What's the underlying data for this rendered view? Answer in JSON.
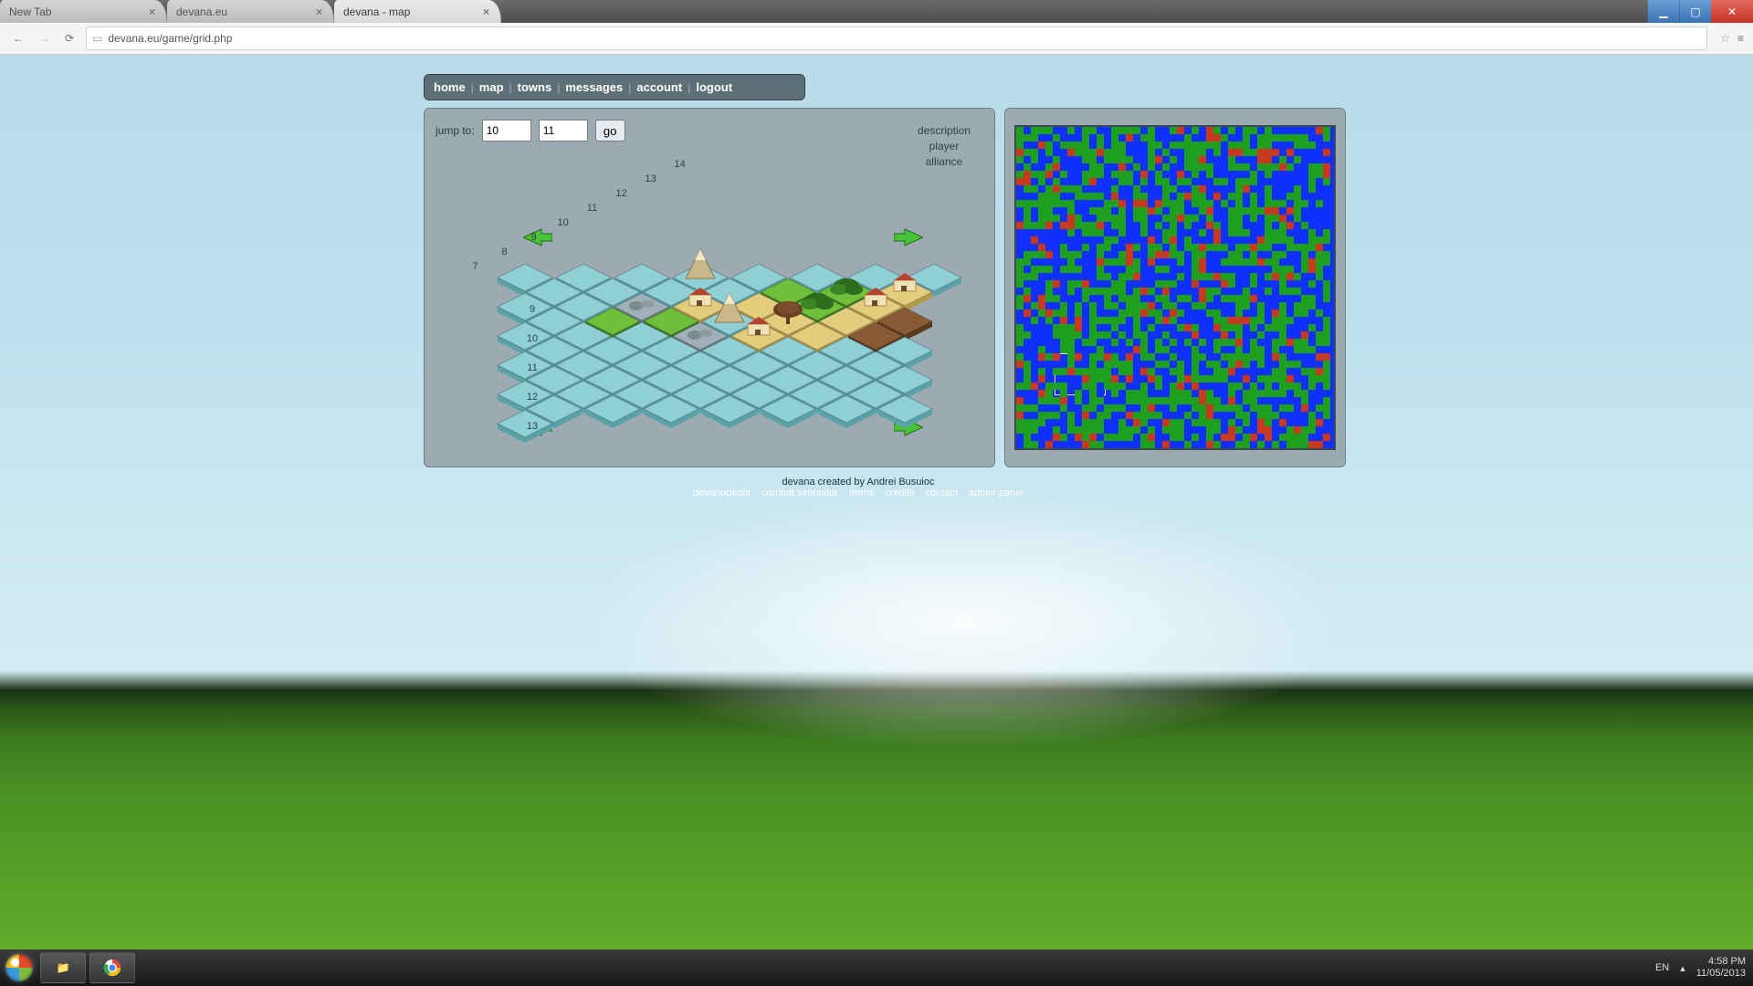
{
  "window": {
    "tabs": [
      {
        "title": "New Tab"
      },
      {
        "title": "devana.eu"
      },
      {
        "title": "devana - map"
      }
    ],
    "url": "devana.eu/game/grid.php"
  },
  "menu": [
    "home",
    "map",
    "towns",
    "messages",
    "account",
    "logout"
  ],
  "jump": {
    "label": "jump to:",
    "x": "10",
    "y": "11",
    "go": "go"
  },
  "info": {
    "l1": "description",
    "l2": "player",
    "l3": "alliance"
  },
  "axes": {
    "left": [
      "14",
      "13",
      "12",
      "11",
      "10",
      "9",
      "8",
      "7"
    ],
    "bottom": [
      "9",
      "10",
      "11",
      "12",
      "13"
    ]
  },
  "tiles": [
    {
      "r": 0,
      "c": 7,
      "t": "water"
    },
    {
      "r": 1,
      "c": 6,
      "t": "water"
    },
    {
      "r": 1,
      "c": 7,
      "t": "town"
    },
    {
      "r": 2,
      "c": 5,
      "t": "water"
    },
    {
      "r": 2,
      "c": 6,
      "t": "forest"
    },
    {
      "r": 2,
      "c": 7,
      "t": "town"
    },
    {
      "r": 2,
      "c": 8,
      "t": "dirt"
    },
    {
      "r": 3,
      "c": 4,
      "t": "water"
    },
    {
      "r": 3,
      "c": 5,
      "t": "grass"
    },
    {
      "r": 3,
      "c": 6,
      "t": "forest"
    },
    {
      "r": 3,
      "c": 7,
      "t": "sand"
    },
    {
      "r": 3,
      "c": 8,
      "t": "dirt"
    },
    {
      "r": 3,
      "c": 9,
      "t": "water"
    },
    {
      "r": 4,
      "c": 3,
      "t": "mountain"
    },
    {
      "r": 4,
      "c": 4,
      "t": "water"
    },
    {
      "r": 4,
      "c": 5,
      "t": "sand"
    },
    {
      "r": 4,
      "c": 6,
      "t": "tree"
    },
    {
      "r": 4,
      "c": 7,
      "t": "sand"
    },
    {
      "r": 4,
      "c": 8,
      "t": "water"
    },
    {
      "r": 4,
      "c": 9,
      "t": "water"
    },
    {
      "r": 4,
      "c": 10,
      "t": "water"
    },
    {
      "r": 5,
      "c": 2,
      "t": "water"
    },
    {
      "r": 5,
      "c": 3,
      "t": "water"
    },
    {
      "r": 5,
      "c": 4,
      "t": "town"
    },
    {
      "r": 5,
      "c": 5,
      "t": "mountain"
    },
    {
      "r": 5,
      "c": 6,
      "t": "town"
    },
    {
      "r": 5,
      "c": 7,
      "t": "water"
    },
    {
      "r": 5,
      "c": 8,
      "t": "water"
    },
    {
      "r": 5,
      "c": 9,
      "t": "water"
    },
    {
      "r": 5,
      "c": 10,
      "t": "water"
    },
    {
      "r": 5,
      "c": 11,
      "t": "water"
    },
    {
      "r": 6,
      "c": 1,
      "t": "water"
    },
    {
      "r": 6,
      "c": 2,
      "t": "water"
    },
    {
      "r": 6,
      "c": 3,
      "t": "rocks"
    },
    {
      "r": 6,
      "c": 4,
      "t": "grass"
    },
    {
      "r": 6,
      "c": 5,
      "t": "rocks"
    },
    {
      "r": 6,
      "c": 6,
      "t": "water"
    },
    {
      "r": 6,
      "c": 7,
      "t": "water"
    },
    {
      "r": 6,
      "c": 8,
      "t": "water"
    },
    {
      "r": 6,
      "c": 9,
      "t": "water"
    },
    {
      "r": 6,
      "c": 10,
      "t": "water"
    },
    {
      "r": 7,
      "c": 0,
      "t": "water"
    },
    {
      "r": 7,
      "c": 1,
      "t": "water"
    },
    {
      "r": 7,
      "c": 2,
      "t": "water"
    },
    {
      "r": 7,
      "c": 3,
      "t": "grass"
    },
    {
      "r": 7,
      "c": 4,
      "t": "water"
    },
    {
      "r": 7,
      "c": 5,
      "t": "water"
    },
    {
      "r": 7,
      "c": 6,
      "t": "water"
    },
    {
      "r": 7,
      "c": 7,
      "t": "water"
    },
    {
      "r": 7,
      "c": 8,
      "t": "water"
    },
    {
      "r": 7,
      "c": 9,
      "t": "water"
    },
    {
      "r": 8,
      "c": 1,
      "t": "water"
    },
    {
      "r": 8,
      "c": 2,
      "t": "water"
    },
    {
      "r": 8,
      "c": 3,
      "t": "water"
    },
    {
      "r": 8,
      "c": 4,
      "t": "water"
    },
    {
      "r": 8,
      "c": 5,
      "t": "water"
    },
    {
      "r": 8,
      "c": 6,
      "t": "water"
    },
    {
      "r": 8,
      "c": 7,
      "t": "water"
    },
    {
      "r": 8,
      "c": 8,
      "t": "water"
    },
    {
      "r": 9,
      "c": 2,
      "t": "water"
    },
    {
      "r": 9,
      "c": 3,
      "t": "water"
    },
    {
      "r": 9,
      "c": 4,
      "t": "water"
    },
    {
      "r": 9,
      "c": 5,
      "t": "water"
    },
    {
      "r": 9,
      "c": 6,
      "t": "water"
    },
    {
      "r": 9,
      "c": 7,
      "t": "water"
    },
    {
      "r": 10,
      "c": 3,
      "t": "water"
    },
    {
      "r": 10,
      "c": 4,
      "t": "water"
    },
    {
      "r": 10,
      "c": 5,
      "t": "water"
    },
    {
      "r": 10,
      "c": 6,
      "t": "water"
    },
    {
      "r": 11,
      "c": 4,
      "t": "water"
    },
    {
      "r": 11,
      "c": 5,
      "t": "water"
    },
    {
      "r": 12,
      "c": 5,
      "t": "water"
    }
  ],
  "footer": {
    "credit": "devana created by Andrei Busuioc",
    "links": [
      "devanopedia",
      "combat simulator",
      "terms",
      "credits",
      "contact",
      "admin panel"
    ]
  },
  "tray": {
    "lang": "EN",
    "time": "4:58 PM",
    "date": "11/05/2013"
  }
}
